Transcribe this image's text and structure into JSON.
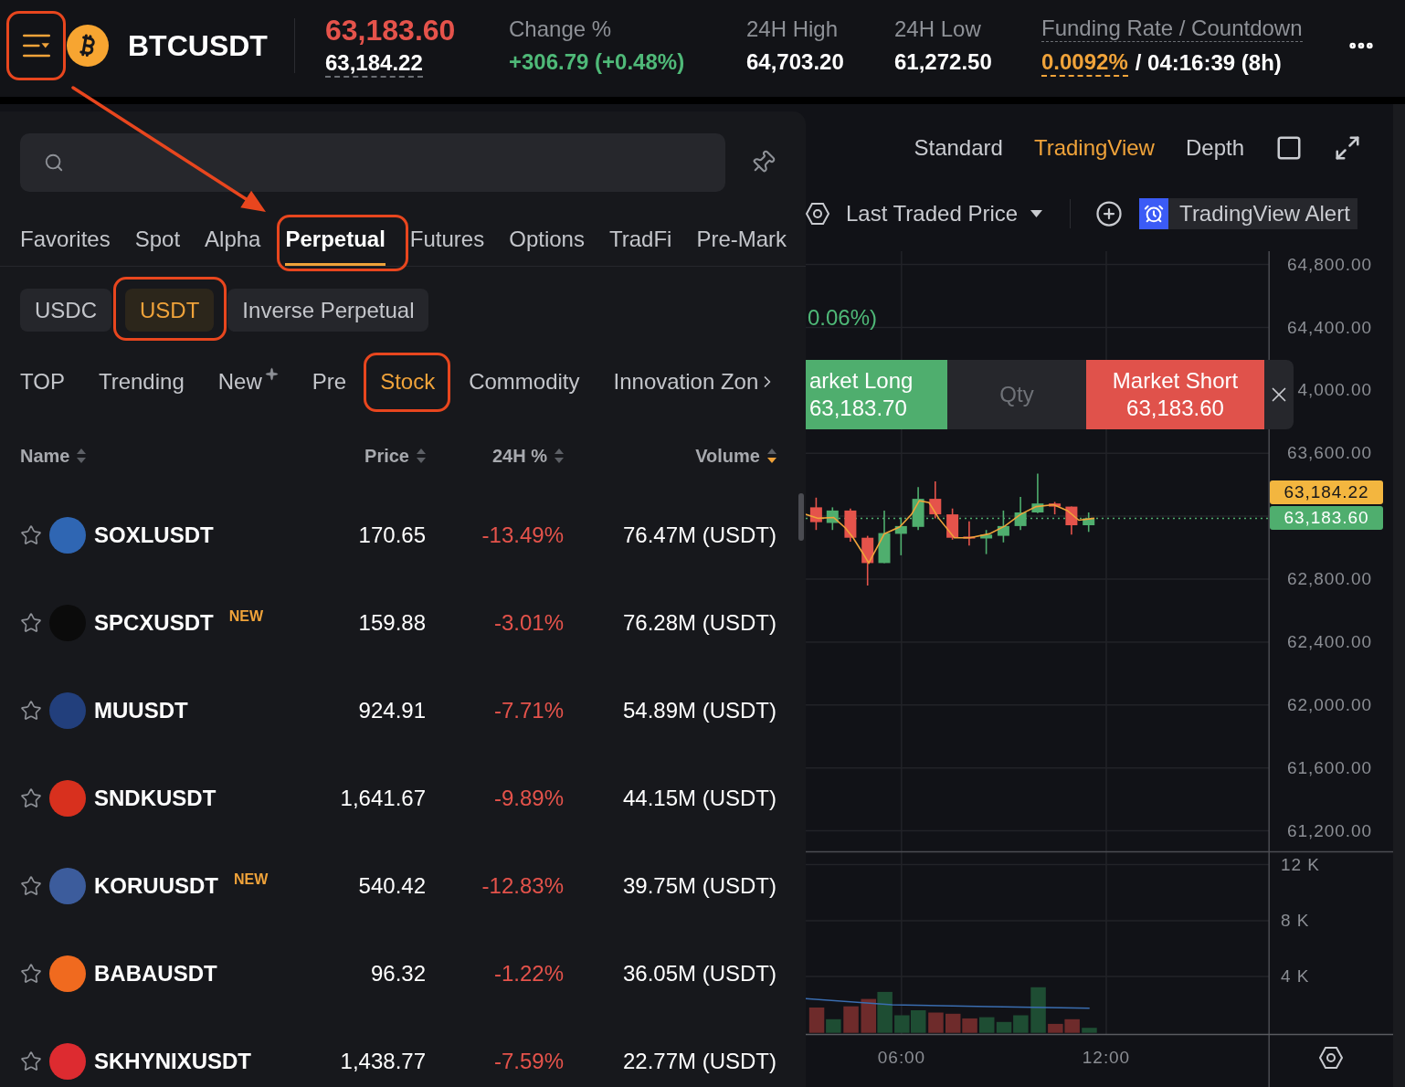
{
  "header": {
    "symbol": "BTCUSDT",
    "last_price": "63,183.60",
    "last_price_falling": true,
    "mark_price": "63,184.22",
    "stats": [
      {
        "kind": "change",
        "label": "Change %",
        "value": "+306.79 (+0.48%)",
        "rising": true
      },
      {
        "kind": "plain",
        "label": "24H High",
        "value": "64,703.20"
      },
      {
        "kind": "plain",
        "label": "24H Low",
        "value": "61,272.50"
      },
      {
        "kind": "funding",
        "label": "Funding Rate / Countdown",
        "value": "0.0092%",
        "countdown": "/ 04:16:39 (8h)"
      }
    ]
  },
  "market_panel": {
    "category_tabs": [
      {
        "label": "Favorites",
        "selected": false
      },
      {
        "label": "Spot",
        "selected": false
      },
      {
        "label": "Alpha",
        "selected": false
      },
      {
        "label": "Perpetual",
        "selected": true
      },
      {
        "label": "Futures",
        "selected": false
      },
      {
        "label": "Options",
        "selected": false
      },
      {
        "label": "TradFi",
        "selected": false
      },
      {
        "label": "Pre-Mark",
        "selected": false
      }
    ],
    "quote_tabs": [
      {
        "label": "USDC",
        "selected": false
      },
      {
        "label": "USDT",
        "selected": true
      },
      {
        "label": "Inverse Perpetual",
        "selected": false
      }
    ],
    "filter_tabs": [
      {
        "label": "TOP",
        "selected": false,
        "sparkle": false
      },
      {
        "label": "Trending",
        "selected": false,
        "sparkle": false
      },
      {
        "label": "New",
        "selected": false,
        "sparkle": true
      },
      {
        "label": "Pre",
        "selected": false,
        "sparkle": false
      },
      {
        "label": "Stock",
        "selected": true,
        "sparkle": false
      },
      {
        "label": "Commodity",
        "selected": false,
        "sparkle": false
      },
      {
        "label": "Innovation Zon",
        "selected": false,
        "sparkle": false
      }
    ],
    "columns": [
      {
        "label": "Name",
        "sorted_desc": false
      },
      {
        "label": "Price",
        "sorted_desc": false
      },
      {
        "label": "24H %",
        "sorted_desc": false
      },
      {
        "label": "Volume",
        "sorted_desc": true
      }
    ],
    "rows": [
      {
        "favorite": false,
        "color": "#2f66b3",
        "symbol": "SOXLUSDT",
        "price": "170.65",
        "change": "-13.49%",
        "falling": true,
        "volume": "76.47M (USDT)"
      },
      {
        "favorite": false,
        "color": "#0b0b0b",
        "symbol": "SPCXUSDT",
        "badge": "NEW",
        "price": "159.88",
        "change": "-3.01%",
        "falling": true,
        "volume": "76.28M (USDT)"
      },
      {
        "favorite": false,
        "color": "#223f7c",
        "symbol": "MUUSDT",
        "price": "924.91",
        "change": "-7.71%",
        "falling": true,
        "volume": "54.89M (USDT)"
      },
      {
        "favorite": false,
        "color": "#d8301e",
        "symbol": "SNDKUSDT",
        "price": "1,641.67",
        "change": "-9.89%",
        "falling": true,
        "volume": "44.15M (USDT)"
      },
      {
        "favorite": false,
        "color": "#3c5c9c",
        "symbol": "KORUUSDT",
        "badge": "NEW",
        "price": "540.42",
        "change": "-12.83%",
        "falling": true,
        "volume": "39.75M (USDT)"
      },
      {
        "favorite": false,
        "color": "#f06a1f",
        "symbol": "BABAUSDT",
        "price": "96.32",
        "change": "-1.22%",
        "falling": true,
        "volume": "36.05M (USDT)"
      },
      {
        "favorite": false,
        "color": "#dd2b30",
        "symbol": "SKHYNIXUSDT",
        "price": "1,438.77",
        "change": "-7.59%",
        "falling": true,
        "volume": "22.77M (USDT)"
      }
    ]
  },
  "chart": {
    "view_tabs": [
      {
        "label": "Standard",
        "selected": false
      },
      {
        "label": "TradingView",
        "selected": true
      },
      {
        "label": "Depth",
        "selected": false
      }
    ],
    "price_source": "Last Traded Price",
    "alert_button": "TradingView Alert",
    "legend_fragment": "0.06%)",
    "quick_trade": {
      "long_label": "arket Long",
      "long_price": "63,183.70",
      "qty": {
        "placeholder": "Qty"
      },
      "short_label": "Market Short",
      "short_price": "63,183.60"
    },
    "price_axis": [
      "64,800.00",
      "64,400.00",
      "4,000.00",
      "63,600.00",
      "62,800.00",
      "62,400.00",
      "62,000.00",
      "61,600.00",
      "61,200.00"
    ],
    "price_tags": [
      {
        "kind": "mark",
        "value": "63,184.22"
      },
      {
        "kind": "last",
        "value": "63,183.60"
      }
    ],
    "volume_axis": [
      "12 K",
      "8 K",
      "4 K"
    ],
    "time_axis": [
      "06:00",
      "12:00"
    ]
  },
  "annotations": [
    {
      "kind": "outline"
    },
    {
      "kind": "arrow"
    },
    {
      "kind": "outline"
    },
    {
      "kind": "outline"
    },
    {
      "kind": "outline"
    }
  ]
}
